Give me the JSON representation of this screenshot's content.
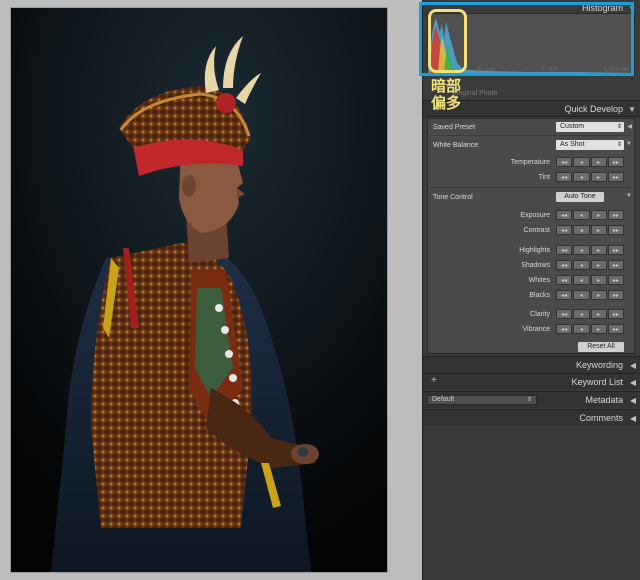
{
  "histogram": {
    "title": "Histogram",
    "readout": [
      "",
      "82 mm",
      "f / 8.0",
      "1/200 sec"
    ],
    "label": "Original Photo"
  },
  "annotation": {
    "line1": "暗部",
    "line2": "偏多"
  },
  "quick_develop": {
    "title": "Quick Develop",
    "saved_preset_label": "Saved Preset",
    "saved_preset_value": "Custom",
    "white_balance_label": "White Balance",
    "white_balance_value": "As Shot",
    "temperature_label": "Temperature",
    "tint_label": "Tint",
    "tone_control_label": "Tone Control",
    "auto_tone_label": "Auto Tone",
    "exposure_label": "Exposure",
    "contrast_label": "Contrast",
    "highlights_label": "Highlights",
    "shadows_label": "Shadows",
    "whites_label": "Whites",
    "blacks_label": "Blacks",
    "clarity_label": "Clarity",
    "vibrance_label": "Vibrance",
    "reset_all_label": "Reset All",
    "step_glyphs": [
      "◂◂",
      "◂",
      "▸",
      "▸▸"
    ]
  },
  "keywording": {
    "title": "Keywording"
  },
  "keyword_list": {
    "title": "Keyword List"
  },
  "metadata": {
    "title": "Metadata",
    "preset": "Default"
  },
  "comments": {
    "title": "Comments"
  },
  "colors": {
    "highlight_blue": "#1aa0d8",
    "annotation_yellow": "#f2e27a"
  }
}
